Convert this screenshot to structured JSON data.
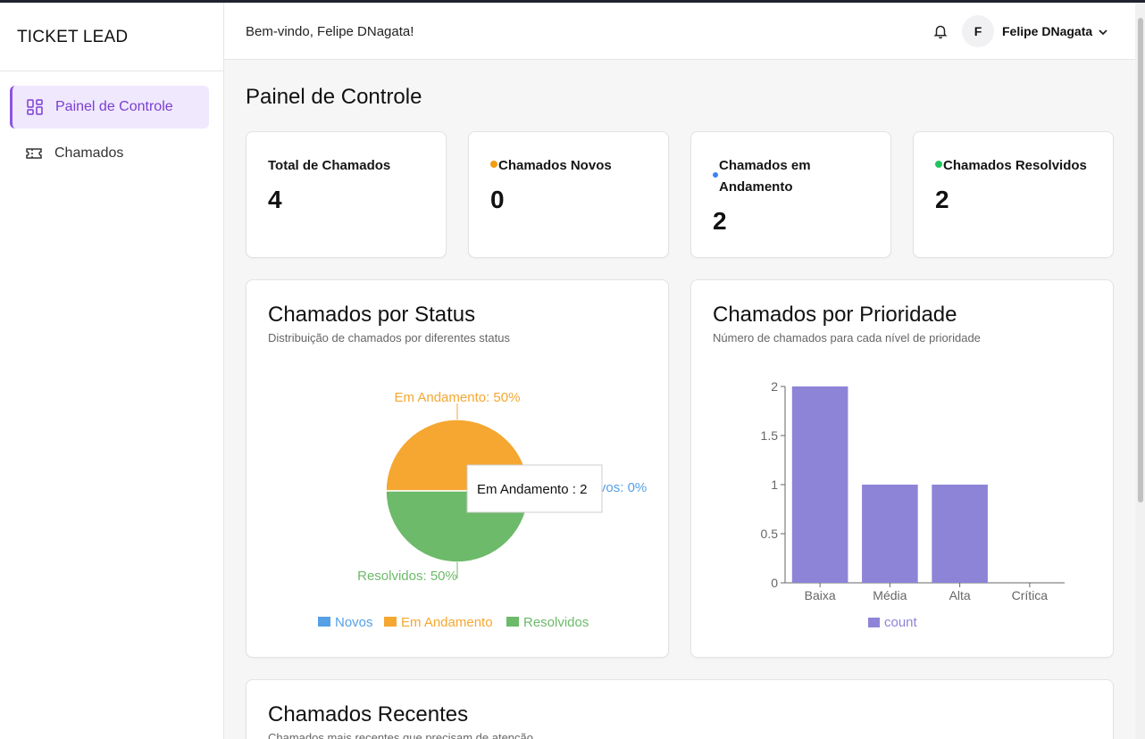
{
  "app": {
    "brand": "TICKET LEAD"
  },
  "sidebar": {
    "items": [
      {
        "label": "Painel de Controle",
        "icon": "dashboard-icon",
        "active": true
      },
      {
        "label": "Chamados",
        "icon": "ticket-icon",
        "active": false
      }
    ]
  },
  "header": {
    "welcome": "Bem-vindo, Felipe DNagata!",
    "avatar_initial": "F",
    "user_name": "Felipe DNagata",
    "notification_icon": "bell-icon",
    "menu_icon": "chevron-down-icon"
  },
  "page": {
    "title": "Painel de Controle"
  },
  "stats": [
    {
      "label": "Total de Chamados",
      "value": "4",
      "dot": null
    },
    {
      "label": "Chamados Novos",
      "value": "0",
      "dot": "#f39c12"
    },
    {
      "label": "Chamados em Andamento",
      "value": "2",
      "dot": "#3b82f6"
    },
    {
      "label": "Chamados Resolvidos",
      "value": "2",
      "dot": "#22c55e"
    }
  ],
  "status_card": {
    "title": "Chamados por Status",
    "subtitle": "Distribuição de chamados por diferentes status"
  },
  "priority_card": {
    "title": "Chamados por Prioridade",
    "subtitle": "Número de chamados para cada nível de prioridade"
  },
  "recent_card": {
    "title": "Chamados Recentes",
    "subtitle": "Chamados mais recentes que precisam de atenção"
  },
  "colors": {
    "novos": "#57a0e5",
    "em_andamento": "#f5a731",
    "resolvidos": "#6dba6a",
    "bar": "#8d84d8",
    "accent": "#7a3fd3"
  },
  "chart_data": [
    {
      "type": "pie",
      "categories": [
        "Novos",
        "Em Andamento",
        "Resolvidos"
      ],
      "values": [
        0,
        2,
        2
      ],
      "slice_labels": [
        "Novos: 0%",
        "Em Andamento: 50%",
        "Resolvidos: 50%"
      ],
      "legend": [
        "Novos",
        "Em Andamento",
        "Resolvidos"
      ],
      "legend_position": "bottom",
      "tooltip": "Em Andamento : 2"
    },
    {
      "type": "bar",
      "categories": [
        "Baixa",
        "Média",
        "Alta",
        "Crítica"
      ],
      "values": [
        2,
        1,
        1,
        0
      ],
      "series": [
        {
          "name": "count",
          "values": [
            2,
            1,
            1,
            0
          ]
        }
      ],
      "yticks": [
        "0",
        "0.5",
        "1",
        "1.5",
        "2"
      ],
      "ylim": [
        0,
        2
      ],
      "legend_position": "bottom"
    }
  ]
}
